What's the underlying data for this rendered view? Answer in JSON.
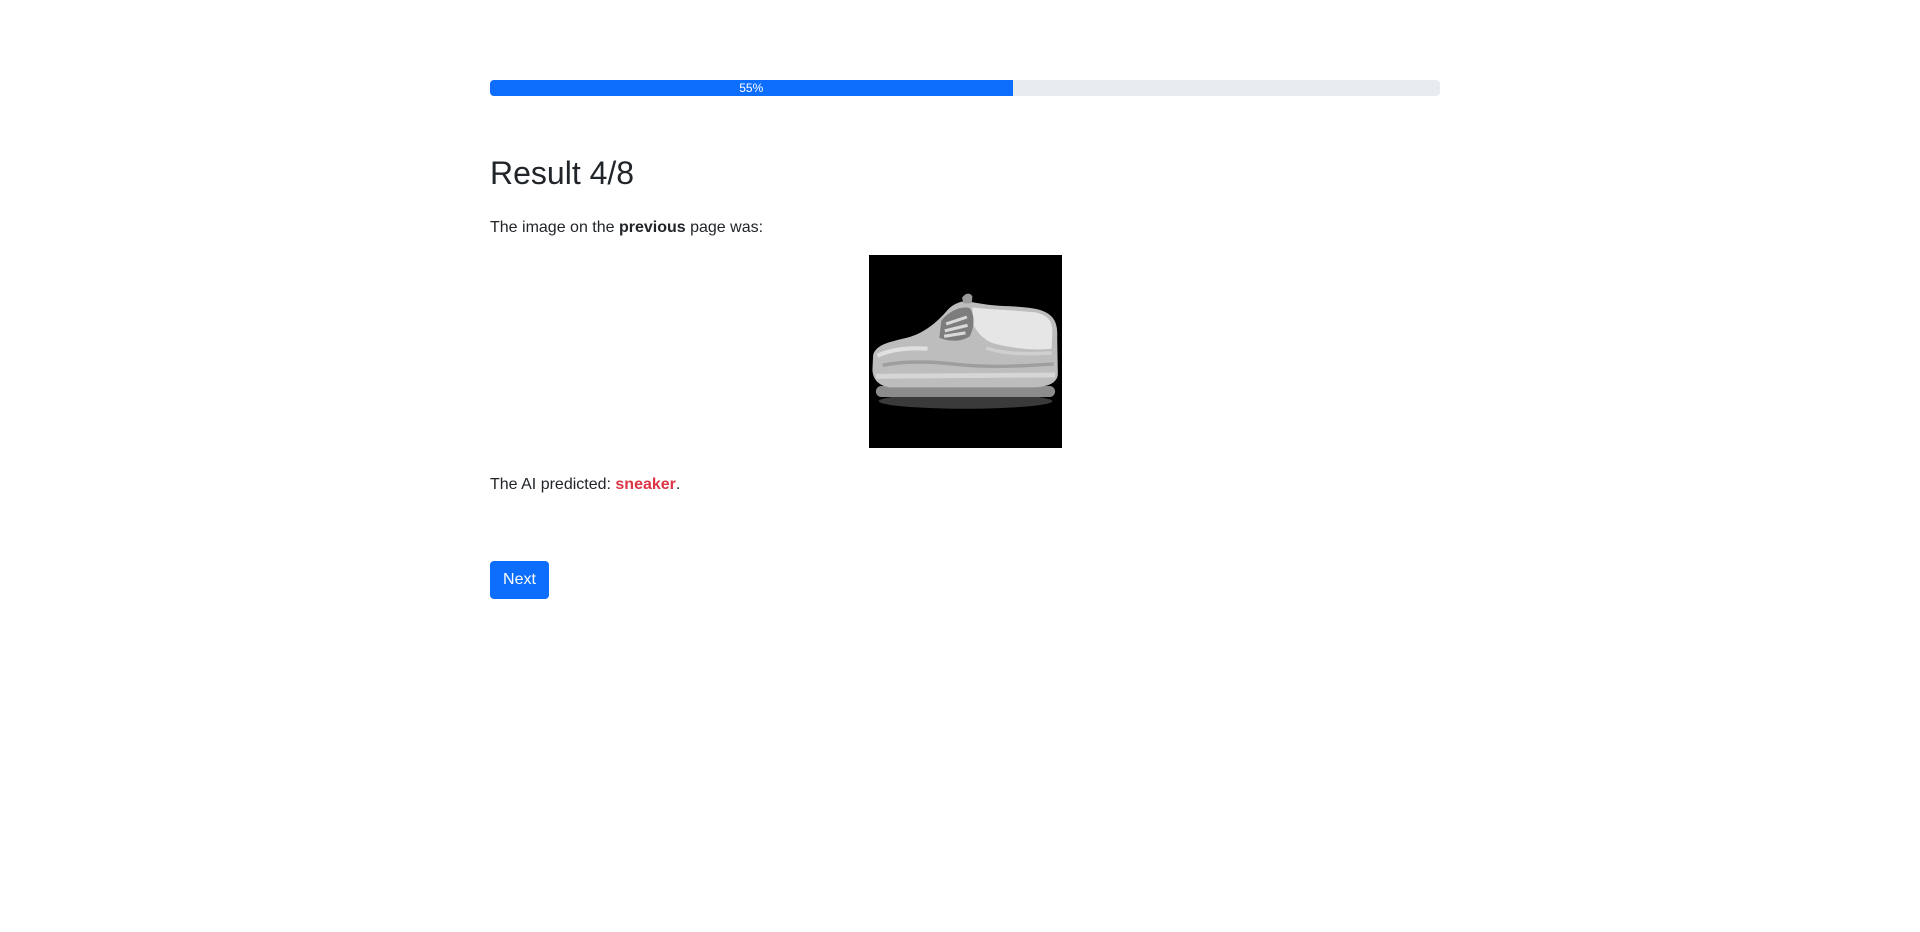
{
  "progress": {
    "label": "55%",
    "value": 0.55
  },
  "result": {
    "title": "Result 4/8",
    "intro_before": "The image on the ",
    "intro_bold": "previous",
    "intro_after": " page was:",
    "image_icon": "sneaker-image",
    "prediction_prefix": "The AI predicted: ",
    "prediction_value": "sneaker",
    "prediction_suffix": ".",
    "prediction_color": "#dc3545"
  },
  "actions": {
    "next_label": "Next"
  },
  "colors": {
    "accent": "#0d6efd",
    "track": "#e9ecef",
    "text": "#212529"
  }
}
